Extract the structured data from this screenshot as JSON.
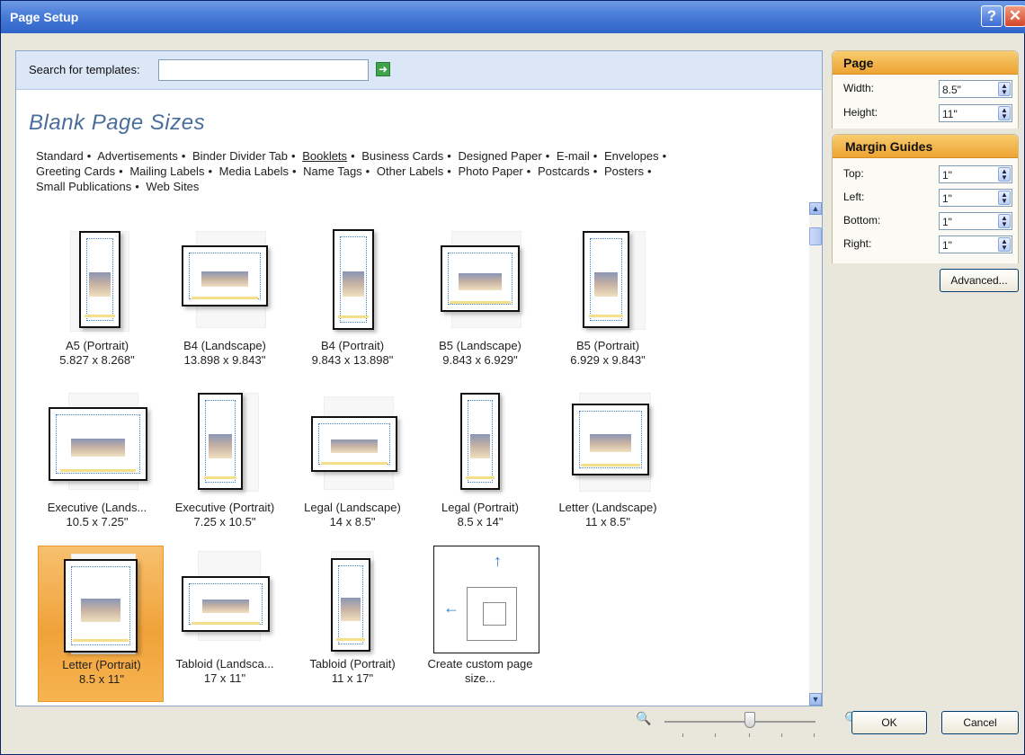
{
  "window": {
    "title": "Page Setup",
    "help_glyph": "?",
    "close_glyph": "✕"
  },
  "search": {
    "label": "Search for templates:",
    "value": "",
    "placeholder": "",
    "go_icon": "arrow-right-icon"
  },
  "main": {
    "heading": "Blank Page Sizes",
    "categories": [
      "Standard",
      "Advertisements",
      "Binder Divider Tab",
      "Booklets",
      "Business Cards",
      "Designed Paper",
      "E-mail",
      "Envelopes",
      "Greeting Cards",
      "Mailing Labels",
      "Media Labels",
      "Name Tags",
      "Other Labels",
      "Photo Paper",
      "Postcards",
      "Posters",
      "Small Publications",
      "Web Sites"
    ],
    "bullet": "•",
    "tiles": [
      {
        "name": "A5 (Portrait)",
        "size": "5.827 x 8.268\""
      },
      {
        "name": "B4 (Landscape)",
        "size": "13.898 x 9.843\""
      },
      {
        "name": "B4 (Portrait)",
        "size": "9.843 x 13.898\""
      },
      {
        "name": "B5 (Landscape)",
        "size": "9.843 x 6.929\""
      },
      {
        "name": "B5 (Portrait)",
        "size": "6.929 x 9.843\""
      },
      {
        "name": "Executive (Lands...",
        "size": "10.5 x 7.25\""
      },
      {
        "name": "Executive (Portrait)",
        "size": "7.25 x 10.5\""
      },
      {
        "name": "Legal (Landscape)",
        "size": "14 x 8.5\""
      },
      {
        "name": "Legal (Portrait)",
        "size": "8.5 x 14\""
      },
      {
        "name": "Letter (Landscape)",
        "size": "11 x 8.5\""
      },
      {
        "name": "Letter (Portrait)",
        "size": "8.5 x 11\"",
        "selected": true
      },
      {
        "name": "Tabloid (Landsca...",
        "size": "17 x 11\""
      },
      {
        "name": "Tabloid (Portrait)",
        "size": "11 x 17\""
      },
      {
        "name": "Create custom page",
        "size": "size..."
      }
    ]
  },
  "page_panel": {
    "title": "Page",
    "width_label": "Width:",
    "width_value": "8.5\"",
    "height_label": "Height:",
    "height_value": "11\""
  },
  "margin_panel": {
    "title": "Margin Guides",
    "top_label": "Top:",
    "top_value": "1\"",
    "left_label": "Left:",
    "left_value": "1\"",
    "bottom_label": "Bottom:",
    "bottom_value": "1\"",
    "right_label": "Right:",
    "right_value": "1\""
  },
  "buttons": {
    "advanced": "Advanced...",
    "ok": "OK",
    "cancel": "Cancel"
  },
  "zoom": {
    "out_icon": "zoom-out-icon",
    "in_icon": "zoom-in-icon"
  }
}
